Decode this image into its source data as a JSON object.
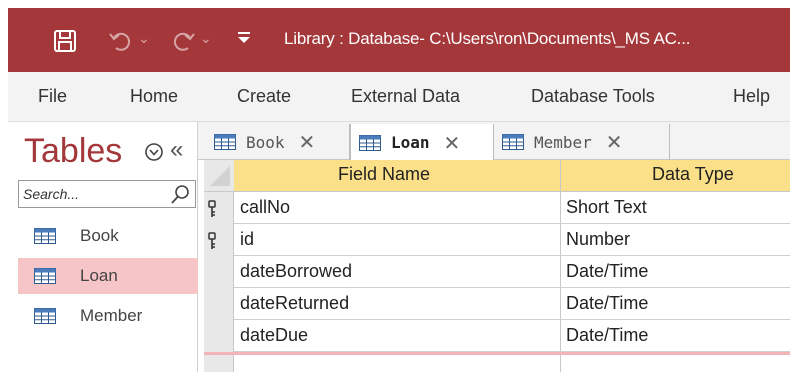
{
  "titlebar": {
    "title": "Library : Database- C:\\Users\\ron\\Documents\\_MS AC...",
    "icons": [
      "save-icon",
      "undo-icon",
      "redo-icon",
      "customize-qat-icon"
    ],
    "color": "#a4373a"
  },
  "ribbon": {
    "tabs": [
      "File",
      "Home",
      "Create",
      "External Data",
      "Database Tools",
      "Help"
    ]
  },
  "nav": {
    "title": "Tables",
    "search_placeholder": "Search...",
    "items": [
      {
        "label": "Book",
        "active": false
      },
      {
        "label": "Loan",
        "active": true
      },
      {
        "label": "Member",
        "active": false
      }
    ],
    "active_color": "#f5c5c7"
  },
  "doc_tabs": [
    {
      "label": "Book",
      "active": false
    },
    {
      "label": "Loan",
      "active": true
    },
    {
      "label": "Member",
      "active": false
    }
  ],
  "grid": {
    "headers": {
      "field_name": "Field Name",
      "data_type": "Data Type"
    },
    "header_color": "#fbe089",
    "rows": [
      {
        "name": "callNo",
        "type": "Short Text",
        "primary_key": true
      },
      {
        "name": "id",
        "type": "Number",
        "primary_key": true
      },
      {
        "name": "dateBorrowed",
        "type": "Date/Time",
        "primary_key": false
      },
      {
        "name": "dateReturned",
        "type": "Date/Time",
        "primary_key": false
      },
      {
        "name": "dateDue",
        "type": "Date/Time",
        "primary_key": false
      }
    ]
  }
}
